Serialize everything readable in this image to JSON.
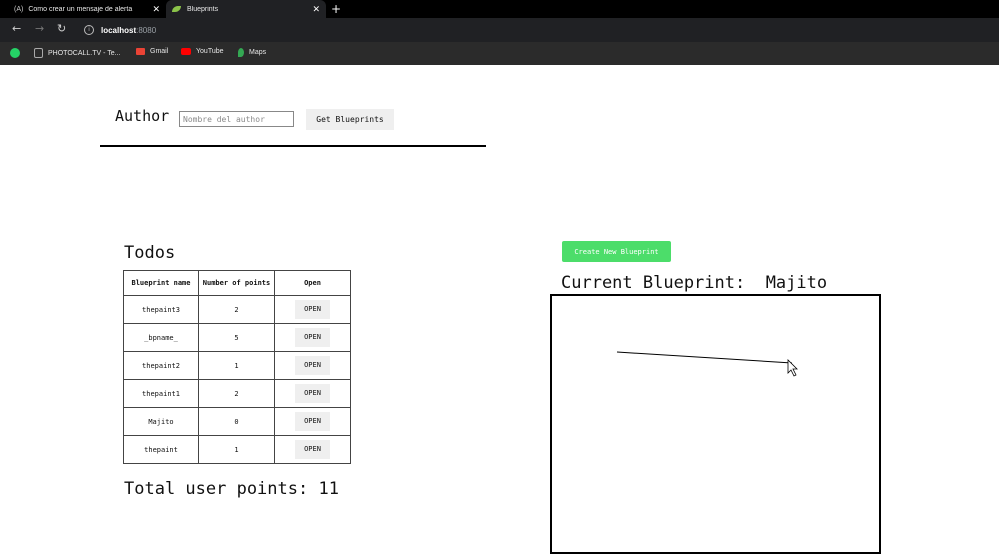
{
  "browser": {
    "tabs": [
      {
        "prefix": "(A)",
        "title": "Como crear un mensaje de alerta"
      },
      {
        "prefix": "",
        "title": "Blueprints"
      }
    ],
    "url_host": "localhost",
    "url_port": ":8080",
    "bookmarks": [
      "PHOTOCALL.TV - Te...",
      "Gmail",
      "YouTube",
      "Maps"
    ]
  },
  "author": {
    "label": "Author",
    "placeholder": "Nombre del author",
    "button": "Get Blueprints"
  },
  "todos": {
    "title": "Todos",
    "headers": [
      "Blueprint name",
      "Number of points",
      "Open"
    ],
    "rows": [
      {
        "name": "thepaint3",
        "points": "2",
        "open": "OPEN"
      },
      {
        "name": "_bpname_",
        "points": "5",
        "open": "OPEN"
      },
      {
        "name": "thepaint2",
        "points": "1",
        "open": "OPEN"
      },
      {
        "name": "thepaint1",
        "points": "2",
        "open": "OPEN"
      },
      {
        "name": "Majito",
        "points": "0",
        "open": "OPEN"
      },
      {
        "name": "thepaint",
        "points": "1",
        "open": "OPEN"
      }
    ],
    "total": "Total user points: 11"
  },
  "blueprint": {
    "create_button": "Create New Blueprint",
    "current": "Current Blueprint:  Majito"
  }
}
